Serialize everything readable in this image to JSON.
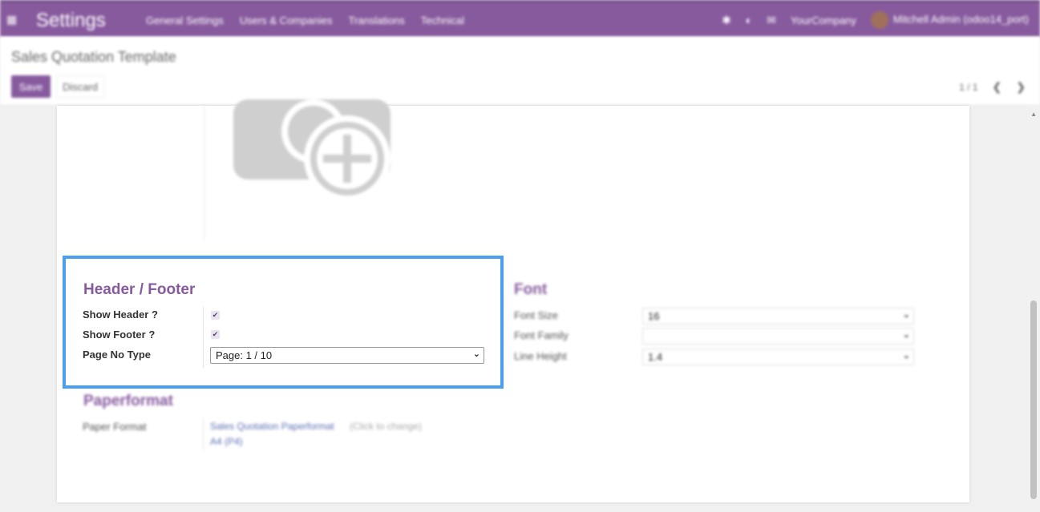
{
  "navbar": {
    "brand": "Settings",
    "menu": [
      "General Settings",
      "Users & Companies",
      "Translations",
      "Technical"
    ],
    "activity_badge": "",
    "messages_badge": "",
    "company": "YourCompany",
    "user": "Mitchell Admin (odoo14_port)",
    "colors": {
      "primary": "#875a9e"
    }
  },
  "control": {
    "breadcrumb": "Sales Quotation Template",
    "save_label": "Save",
    "discard_label": "Discard",
    "pager": "1 / 1"
  },
  "header_footer": {
    "title": "Header / Footer",
    "show_header_label": "Show Header ?",
    "show_header_checked": true,
    "show_footer_label": "Show Footer ?",
    "show_footer_checked": true,
    "page_no_type_label": "Page No Type",
    "page_no_type_value": "Page: 1 / 10"
  },
  "font": {
    "title": "Font",
    "font_size_label": "Font Size",
    "font_size_value": "16",
    "font_family_label": "Font Family",
    "font_family_value": "",
    "line_height_label": "Line Height",
    "line_height_value": "1.4"
  },
  "paperformat": {
    "title": "Paperformat",
    "paper_format_label": "Paper Format",
    "paper_format_value": "Sales Quotation Paperformat",
    "paper_format_hint": "(Click to change)",
    "paper_format_sub": "A4 (P4)"
  }
}
